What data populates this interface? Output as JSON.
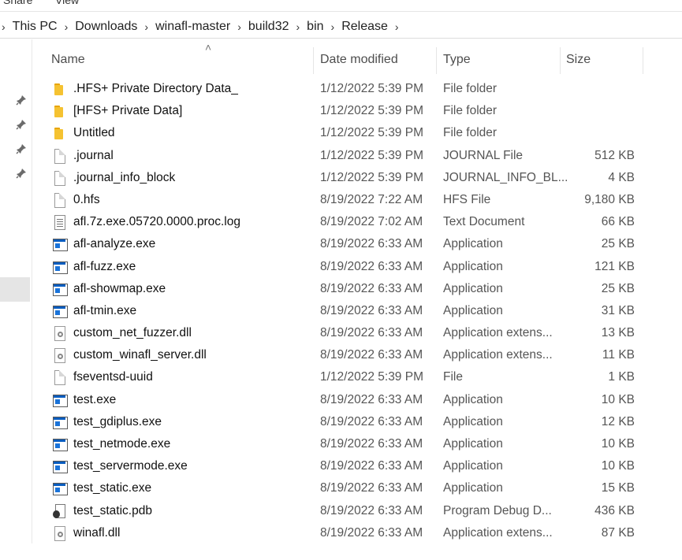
{
  "ribbon": {
    "share": "Share",
    "view": "View"
  },
  "address": [
    "This PC",
    "Downloads",
    "winafl-master",
    "build32",
    "bin",
    "Release"
  ],
  "columns": {
    "name": "Name",
    "date": "Date modified",
    "type": "Type",
    "size": "Size"
  },
  "files": [
    {
      "icon": "folder-icon",
      "name": ".HFS+ Private Directory Data_",
      "date": "1/12/2022 5:39 PM",
      "type": "File folder",
      "size": ""
    },
    {
      "icon": "folder-icon",
      "name": "[HFS+ Private Data]",
      "date": "1/12/2022 5:39 PM",
      "type": "File folder",
      "size": ""
    },
    {
      "icon": "folder-icon",
      "name": "Untitled",
      "date": "1/12/2022 5:39 PM",
      "type": "File folder",
      "size": ""
    },
    {
      "icon": "file-icon",
      "name": ".journal",
      "date": "1/12/2022 5:39 PM",
      "type": "JOURNAL File",
      "size": "512 KB"
    },
    {
      "icon": "file-icon",
      "name": ".journal_info_block",
      "date": "1/12/2022 5:39 PM",
      "type": "JOURNAL_INFO_BL...",
      "size": "4 KB"
    },
    {
      "icon": "file-icon",
      "name": "0.hfs",
      "date": "8/19/2022 7:22 AM",
      "type": "HFS File",
      "size": "9,180 KB"
    },
    {
      "icon": "text-document-icon",
      "name": "afl.7z.exe.05720.0000.proc.log",
      "date": "8/19/2022 7:02 AM",
      "type": "Text Document",
      "size": "66 KB"
    },
    {
      "icon": "application-icon",
      "name": "afl-analyze.exe",
      "date": "8/19/2022 6:33 AM",
      "type": "Application",
      "size": "25 KB"
    },
    {
      "icon": "application-icon",
      "name": "afl-fuzz.exe",
      "date": "8/19/2022 6:33 AM",
      "type": "Application",
      "size": "121 KB"
    },
    {
      "icon": "application-icon",
      "name": "afl-showmap.exe",
      "date": "8/19/2022 6:33 AM",
      "type": "Application",
      "size": "25 KB"
    },
    {
      "icon": "application-icon",
      "name": "afl-tmin.exe",
      "date": "8/19/2022 6:33 AM",
      "type": "Application",
      "size": "31 KB"
    },
    {
      "icon": "dll-icon",
      "name": "custom_net_fuzzer.dll",
      "date": "8/19/2022 6:33 AM",
      "type": "Application extens...",
      "size": "13 KB"
    },
    {
      "icon": "dll-icon",
      "name": "custom_winafl_server.dll",
      "date": "8/19/2022 6:33 AM",
      "type": "Application extens...",
      "size": "11 KB"
    },
    {
      "icon": "file-icon",
      "name": "fseventsd-uuid",
      "date": "1/12/2022 5:39 PM",
      "type": "File",
      "size": "1 KB"
    },
    {
      "icon": "application-icon",
      "name": "test.exe",
      "date": "8/19/2022 6:33 AM",
      "type": "Application",
      "size": "10 KB"
    },
    {
      "icon": "application-icon",
      "name": "test_gdiplus.exe",
      "date": "8/19/2022 6:33 AM",
      "type": "Application",
      "size": "12 KB"
    },
    {
      "icon": "application-icon",
      "name": "test_netmode.exe",
      "date": "8/19/2022 6:33 AM",
      "type": "Application",
      "size": "10 KB"
    },
    {
      "icon": "application-icon",
      "name": "test_servermode.exe",
      "date": "8/19/2022 6:33 AM",
      "type": "Application",
      "size": "10 KB"
    },
    {
      "icon": "application-icon",
      "name": "test_static.exe",
      "date": "8/19/2022 6:33 AM",
      "type": "Application",
      "size": "15 KB"
    },
    {
      "icon": "program-debug-database-icon",
      "name": "test_static.pdb",
      "date": "8/19/2022 6:33 AM",
      "type": "Program Debug D...",
      "size": "436 KB"
    },
    {
      "icon": "dll-icon",
      "name": "winafl.dll",
      "date": "8/19/2022 6:33 AM",
      "type": "Application extens...",
      "size": "87 KB"
    }
  ],
  "colors": {
    "folder": "#f5c231",
    "app_blue": "#0a5dbf",
    "selected_bg": "#e5e5e5"
  }
}
